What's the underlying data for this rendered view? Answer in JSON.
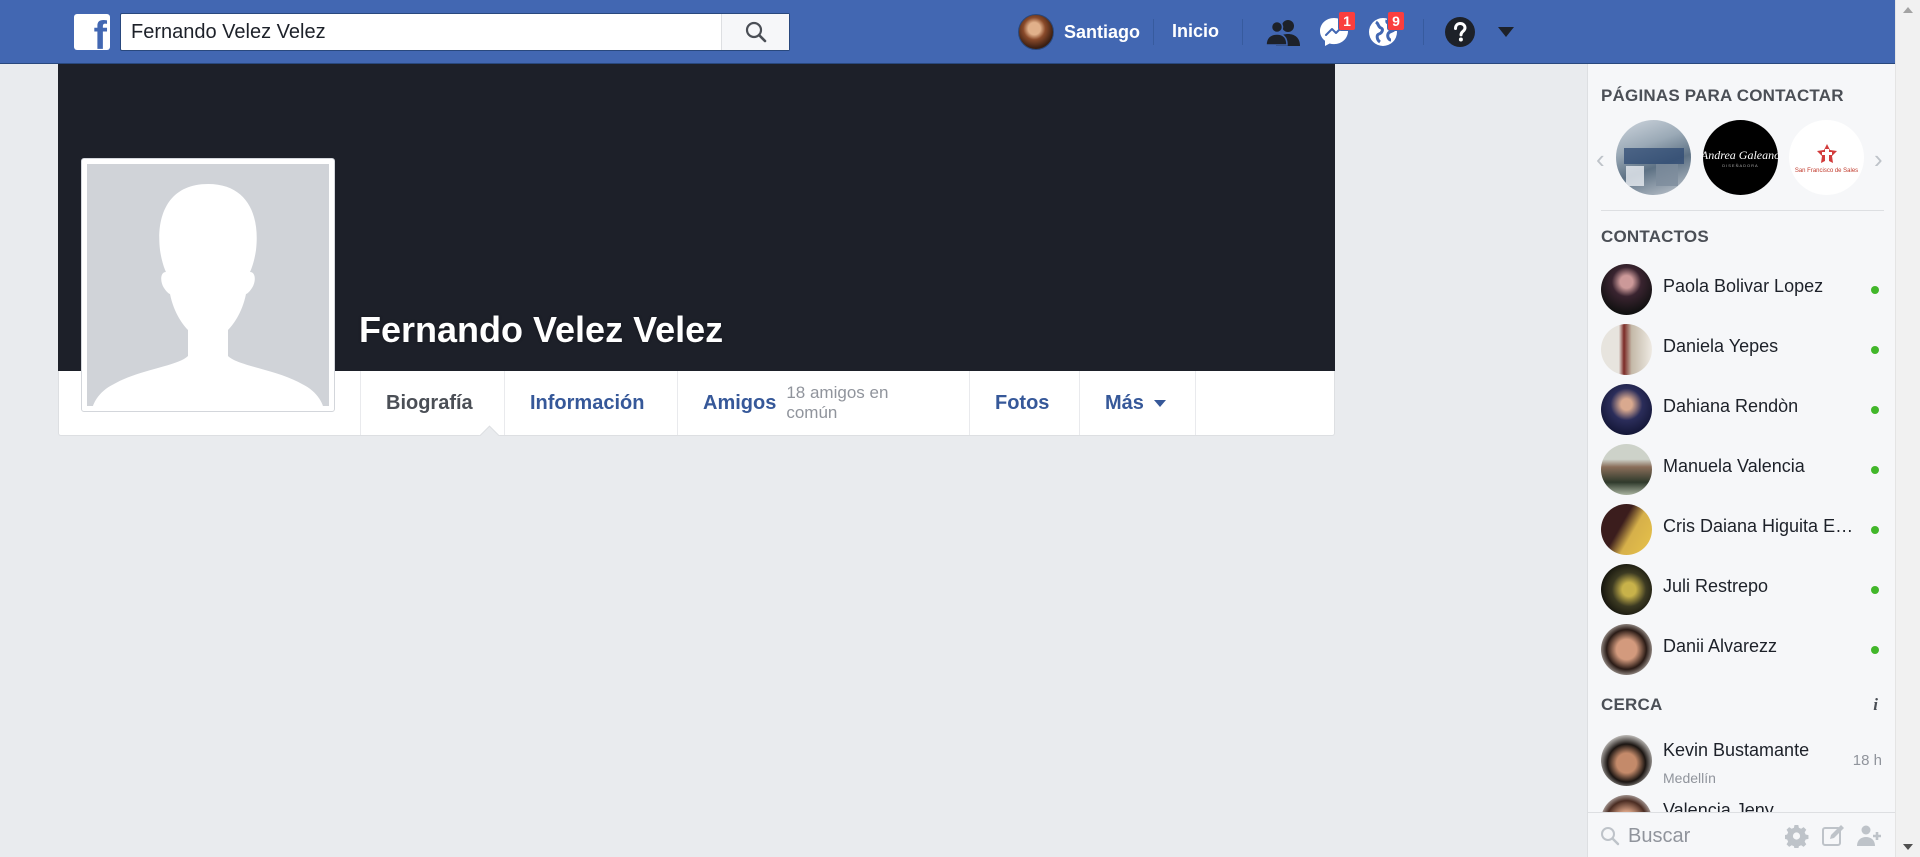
{
  "header": {
    "search_value": "Fernando Velez Velez",
    "user_name": "Santiago",
    "home_label": "Inicio",
    "messages_badge": "1",
    "notifications_badge": "9",
    "brand_color": "#4267b2"
  },
  "profile": {
    "name": "Fernando Velez Velez",
    "tabs": [
      {
        "label": "Biografía",
        "sub": ""
      },
      {
        "label": "Información",
        "sub": ""
      },
      {
        "label": "Amigos",
        "sub": "18 amigos en común"
      },
      {
        "label": "Fotos",
        "sub": ""
      },
      {
        "label": "Más",
        "sub": ""
      }
    ]
  },
  "sidebar": {
    "pages_heading": "PÁGINAS PARA CONTACTAR",
    "pages": [
      {
        "name": "store-page"
      },
      {
        "name": "andrea-galeano-page",
        "logo_text": "Andrea Galeano",
        "logo_sub": "DISEÑADORA"
      },
      {
        "name": "san-francisco-de-sales-page",
        "logo_text": "San Francisco de Sales"
      }
    ],
    "contacts_heading": "CONTACTOS",
    "contacts": [
      {
        "name": "Paola Bolivar Lopez"
      },
      {
        "name": "Daniela Yepes"
      },
      {
        "name": "Dahiana Rendòn"
      },
      {
        "name": "Manuela Valencia"
      },
      {
        "name": "Cris Daiana Higuita Echavarria"
      },
      {
        "name": "Juli Restrepo"
      },
      {
        "name": "Danii Alvarezz"
      }
    ],
    "nearby_heading": "CERCA",
    "nearby": [
      {
        "name": "Kevin Bustamante",
        "location": "Medellín",
        "time": "18 h"
      },
      {
        "name": "Valencia Jeny",
        "location": "",
        "time": ""
      }
    ],
    "search_placeholder": "Buscar",
    "online_color": "#42b72a"
  }
}
